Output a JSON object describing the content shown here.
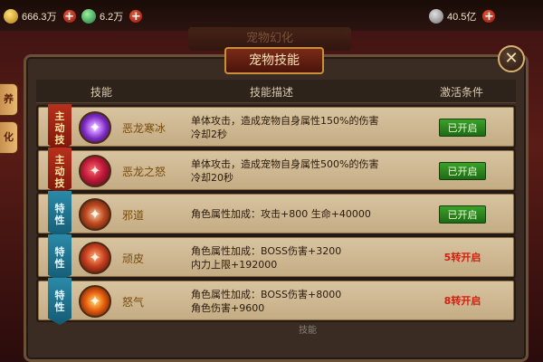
{
  "topbar": {
    "gold": "666.3万",
    "jade": "6.2万",
    "coins": "40.5亿"
  },
  "background": {
    "title": "宠物幻化",
    "side_tabs": [
      "养",
      "化"
    ],
    "bottom_label": "技能"
  },
  "dialog": {
    "title": "宠物技能",
    "close_label": "✕"
  },
  "table": {
    "headers": {
      "skill": "技能",
      "description": "技能描述",
      "condition": "激活条件"
    },
    "rows": [
      {
        "badge": "主\n动\n技",
        "badge_type": "active",
        "icon": "purple-burst-icon",
        "name": "恶龙寒冰",
        "desc_line1": "单体攻击，造成宠物自身属性150%的伤害",
        "desc_line2": "冷却2秒",
        "status": "已开启",
        "status_type": "open"
      },
      {
        "badge": "主\n动\n技",
        "badge_type": "active",
        "icon": "red-dragon-icon",
        "name": "恶龙之怒",
        "desc_line1": "单体攻击，造成宠物自身属性500%的伤害",
        "desc_line2": "冷却20秒",
        "status": "已开启",
        "status_type": "open"
      },
      {
        "badge": "特\n性",
        "badge_type": "trait",
        "icon": "evil-way-icon",
        "name": "邪道",
        "desc_line1": "角色属性加成：攻击+800 生命+40000",
        "desc_line2": "",
        "status": "已开启",
        "status_type": "open"
      },
      {
        "badge": "特\n性",
        "badge_type": "trait",
        "icon": "tough-skin-icon",
        "name": "顽皮",
        "desc_line1": "角色属性加成：BOSS伤害+3200",
        "desc_line2": "内力上限+192000",
        "status": "5转开启",
        "status_type": "locked"
      },
      {
        "badge": "特\n性",
        "badge_type": "trait",
        "icon": "rage-icon",
        "name": "怒气",
        "desc_line1": "角色属性加成：BOSS伤害+8000",
        "desc_line2": "角色伤害+9600",
        "status": "8转开启",
        "status_type": "locked"
      }
    ]
  },
  "colors": {
    "open_green": "#2e8a22",
    "locked_red": "#d42010",
    "active_badge": "#b8301c",
    "trait_badge": "#2a8aa8"
  }
}
